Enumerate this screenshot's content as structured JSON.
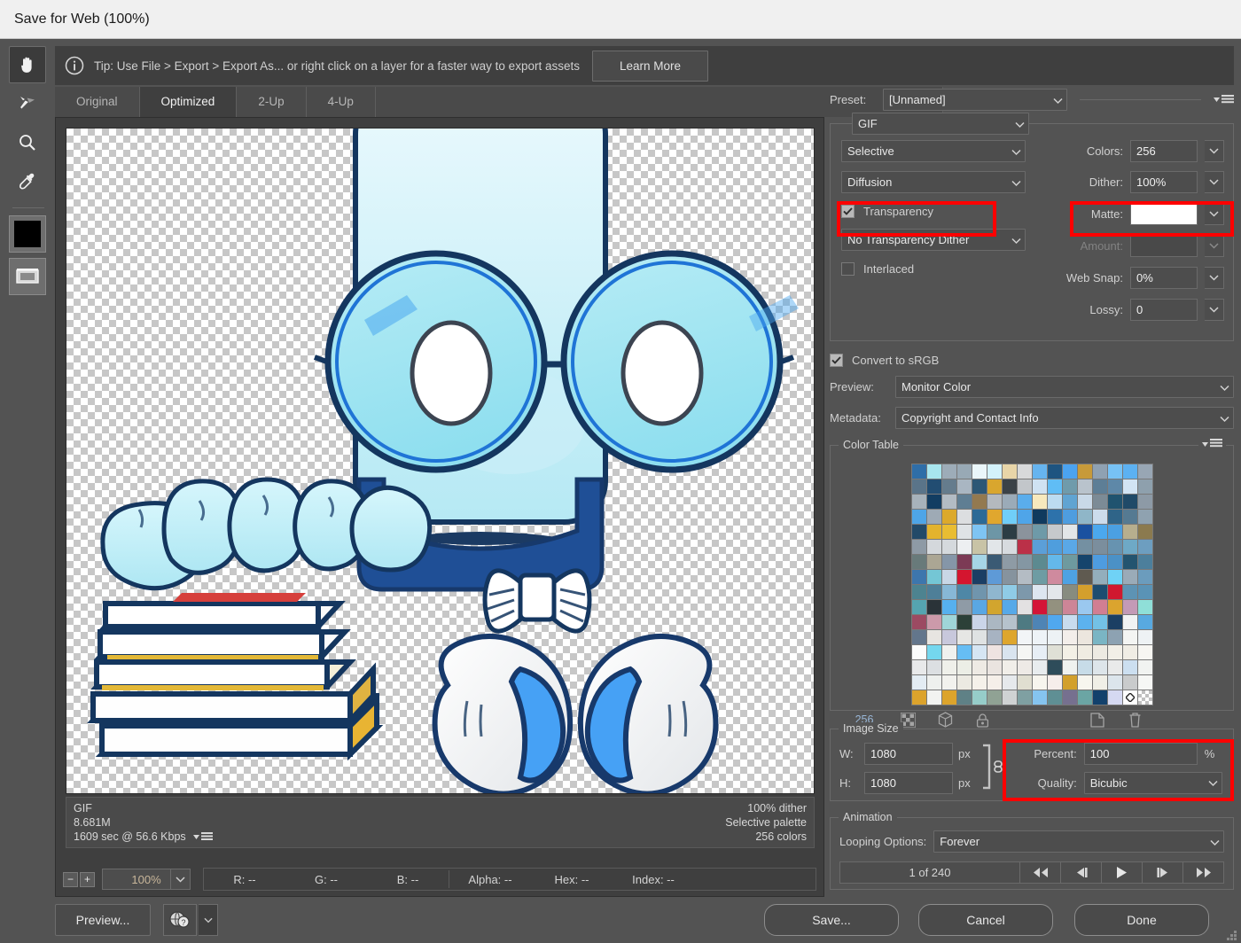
{
  "window": {
    "title": "Save for Web (100%)"
  },
  "tipbar": {
    "info_icon": "info-icon",
    "text": "Tip: Use File > Export > Export As...  or right click on a layer for a faster way to export assets",
    "learn_more_label": "Learn More"
  },
  "toolbar": {
    "tools": [
      {
        "name": "hand-tool",
        "icon": "hand-icon",
        "active": true
      },
      {
        "name": "slice-select-tool",
        "icon": "slice-select-icon",
        "active": false
      },
      {
        "name": "zoom-tool",
        "icon": "magnifier-icon",
        "active": false
      },
      {
        "name": "eyedropper-tool",
        "icon": "eyedropper-icon",
        "active": false
      }
    ],
    "foreground_color": "#000000",
    "toggle_slices_icon": "toggle-slices-icon"
  },
  "tabs": [
    {
      "label": "Original",
      "active": false
    },
    {
      "label": "Optimized",
      "active": true
    },
    {
      "label": "2-Up",
      "active": false
    },
    {
      "label": "4-Up",
      "active": false
    }
  ],
  "preview": {
    "info": {
      "format": "GIF",
      "filesize": "8.681M",
      "download_time": "1609 sec @ 56.6 Kbps",
      "dither": "100% dither",
      "palette": "Selective palette",
      "colors": "256 colors"
    },
    "zoom_level": "100%",
    "readouts": [
      {
        "label": "R:",
        "value": "--"
      },
      {
        "label": "G:",
        "value": "--"
      },
      {
        "label": "B:",
        "value": "--"
      },
      {
        "label": "Alpha:",
        "value": "--"
      },
      {
        "label": "Hex:",
        "value": "--"
      },
      {
        "label": "Index:",
        "value": "--"
      }
    ]
  },
  "settings": {
    "preset_label": "Preset:",
    "preset_value": "[Unnamed]",
    "format_value": "GIF",
    "reduction_value": "Selective",
    "dither_algorithm_value": "Diffusion",
    "transparency_label": "Transparency",
    "transparency_checked": true,
    "transparency_dither_value": "No Transparency Dither",
    "interlaced_label": "Interlaced",
    "interlaced_checked": false,
    "colors_label": "Colors:",
    "colors_value": "256",
    "dither_label": "Dither:",
    "dither_value": "100%",
    "matte_label": "Matte:",
    "matte_color": "#ffffff",
    "amount_label": "Amount:",
    "amount_value": "",
    "web_snap_label": "Web Snap:",
    "web_snap_value": "0%",
    "lossy_label": "Lossy:",
    "lossy_value": "0",
    "convert_srgb_label": "Convert to sRGB",
    "convert_srgb_checked": true,
    "preview_label": "Preview:",
    "preview_value": "Monitor Color",
    "metadata_label": "Metadata:",
    "metadata_value": "Copyright and Contact Info"
  },
  "color_table": {
    "title": "Color Table",
    "count": "256",
    "footer_icons": [
      "web-snap-icon",
      "cube-icon",
      "lock-icon",
      "new-color-icon",
      "trash-icon"
    ],
    "swatches": [
      "#2f6ea8",
      "#a8e6ef",
      "#9dacb8",
      "#98a9b5",
      "#eaf6fa",
      "#d3f2fb",
      "#e8d5a8",
      "#d8d9da",
      "#66b4ef",
      "#1e5480",
      "#4ba3f0",
      "#c79a3a",
      "#8fa1b2",
      "#77c2f5",
      "#5cb1f2",
      "#98a6b4",
      "#5a7489",
      "#224d72",
      "#657c8d",
      "#a9b6c2",
      "#2c5775",
      "#d9a62e",
      "#3b4247",
      "#c2c6ca",
      "#cfe2f2",
      "#60bdf5",
      "#6f9bab",
      "#b9c3cc",
      "#5d7e96",
      "#5e88a8",
      "#d2e4f4",
      "#8ea0ad",
      "#a7b2bb",
      "#123d62",
      "#b3bcc4",
      "#5f7e93",
      "#93794f",
      "#b4b9be",
      "#9babb8",
      "#5aadec",
      "#f7e9bd",
      "#bcdcf1",
      "#60a4d2",
      "#c9d9e8",
      "#7c8b96",
      "#20536f",
      "#204a68",
      "#8d9aa6",
      "#4ea5e7",
      "#9eaab5",
      "#dca92b",
      "#dcdee0",
      "#2c6a96",
      "#e0a72e",
      "#70cef8",
      "#4fa5e9",
      "#0f3a5e",
      "#2d72ab",
      "#4e9ddf",
      "#8fb6c8",
      "#ccdcec",
      "#2f6488",
      "#557a92",
      "#8fa2b0",
      "#234a68",
      "#e3b32d",
      "#e9bd32",
      "#dfe3e6",
      "#7ec4f3",
      "#6d96a6",
      "#2c3d44",
      "#8b939c",
      "#6e9aa8",
      "#c6c9cc",
      "#e3e6e8",
      "#1a51a0",
      "#4ba8ee",
      "#4ba0e2",
      "#b6ae8e",
      "#8b7a4f",
      "#8e9aa5",
      "#d4d8dc",
      "#d5d9dd",
      "#edeff1",
      "#c8c3a6",
      "#e2e6e9",
      "#d7dbdf",
      "#bb3048",
      "#5b9fd8",
      "#4f9edd",
      "#5aa8e7",
      "#7490a2",
      "#7b8e9d",
      "#6793b0",
      "#6ea9c6",
      "#6d9ec0",
      "#687a7a",
      "#aba694",
      "#8596a8",
      "#7c3a55",
      "#a6d5e6",
      "#3a5a74",
      "#8e9ba5",
      "#8497a3",
      "#5c8a90",
      "#64b8ea",
      "#6e9a9f",
      "#15446c",
      "#4e9ce0",
      "#4b91c6",
      "#23546f",
      "#4c7f9c",
      "#3d76ad",
      "#74c6d5",
      "#c9d7e6",
      "#d4152f",
      "#1b3e64",
      "#5e9ad7",
      "#86939e",
      "#b4bcc4",
      "#6e9ca3",
      "#cf8a9e",
      "#4ea2e3",
      "#5f5a50",
      "#93aebc",
      "#6fd2f6",
      "#9aabb8",
      "#6b9cbd",
      "#4d8390",
      "#4e7f98",
      "#87b8d6",
      "#4e87a6",
      "#7095ad",
      "#8fb6cf",
      "#8fcbe6",
      "#7d98ab",
      "#dde6f0",
      "#e3e7eb",
      "#878c80",
      "#d49f2d",
      "#1d4d70",
      "#d0182f",
      "#5d93b4",
      "#5a93b6",
      "#55a4b0",
      "#2a3338",
      "#56b0ee",
      "#8f9ba6",
      "#5aa7e3",
      "#d2a52e",
      "#57a9e8",
      "#e3e1e2",
      "#d41437",
      "#93917f",
      "#cd8597",
      "#9ac8ef",
      "#d17e92",
      "#dba42e",
      "#c39ab6",
      "#8fdfd8",
      "#9c4a62",
      "#cc9aaa",
      "#9fd5d8",
      "#2c4038",
      "#cbd5e8",
      "#abb7c2",
      "#b6c2cc",
      "#4e7a82",
      "#4e84b5",
      "#50a8ef",
      "#c8dcee",
      "#5cb2ee",
      "#73c1e6",
      "#1b3f63",
      "#f0f2f3",
      "#58a9e0",
      "#63768c",
      "#e7e5e1",
      "#c8c8dc",
      "#e6e6e4",
      "#dfe2e3",
      "#a7b3c2",
      "#dea62e",
      "#f2f5f7",
      "#eef3f7",
      "#edf2f5",
      "#f3eeea",
      "#ece6de",
      "#7ab5c4",
      "#8da2b2",
      "#f4f5f3",
      "#eef2f4",
      "#fbfcfc",
      "#74d7ee",
      "#f0f1ef",
      "#66bdf4",
      "#d6e5f3",
      "#eee3e1",
      "#d9e4ef",
      "#f5f6f4",
      "#e7eef5",
      "#dfe0d6",
      "#f3f0e6",
      "#f0ece2",
      "#edeae2",
      "#f2efe7",
      "#f0ede5",
      "#f7f6f2",
      "#e8e9ea",
      "#dcdfe2",
      "#eff0ea",
      "#eceee6",
      "#eeeae4",
      "#eae4e0",
      "#f1eee9",
      "#eeeae6",
      "#e8ecee",
      "#2e4c5a",
      "#eff2ef",
      "#c7dce8",
      "#dde5ea",
      "#e9eaea",
      "#ccdff0",
      "#f1f3f1",
      "#e3ecf3",
      "#eef0ee",
      "#f2f2ee",
      "#eceae2",
      "#f5f1ea",
      "#f5efe9",
      "#e6e9ec",
      "#e0ded0",
      "#f7f5ee",
      "#f6eeeb",
      "#d2a02c",
      "#f7f6ef",
      "#f0efe7",
      "#dce5ec",
      "#c9cbcc",
      "#f6f7f5",
      "#dca32c",
      "#f2f3f1",
      "#dca42c",
      "#5f8186",
      "#96cdc9",
      "#90a294",
      "#cfd2d3",
      "#7fa0a2",
      "#85c4ef",
      "#5f8f94",
      "#76708f",
      "#6ba5a4",
      "#12416c",
      "#d5d9f2",
      "#fefefe",
      "#checker"
    ]
  },
  "image_size": {
    "title": "Image Size",
    "w_label": "W:",
    "w_value": "1080",
    "h_label": "H:",
    "h_value": "1080",
    "unit": "px",
    "percent_label": "Percent:",
    "percent_value": "100",
    "percent_unit": "%",
    "quality_label": "Quality:",
    "quality_value": "Bicubic",
    "link_icon": "chain-link-icon"
  },
  "animation": {
    "title": "Animation",
    "looping_label": "Looping Options:",
    "looping_value": "Forever",
    "frame_counter": "1 of 240",
    "nav_buttons": [
      "first-frame-icon",
      "previous-frame-icon",
      "play-icon",
      "next-frame-icon",
      "last-frame-icon"
    ]
  },
  "footer": {
    "preview_label": "Preview...",
    "browser_icon": "globe-help-icon",
    "save_label": "Save...",
    "cancel_label": "Cancel",
    "done_label": "Done"
  },
  "highlights": {
    "color": "#ff0000"
  }
}
